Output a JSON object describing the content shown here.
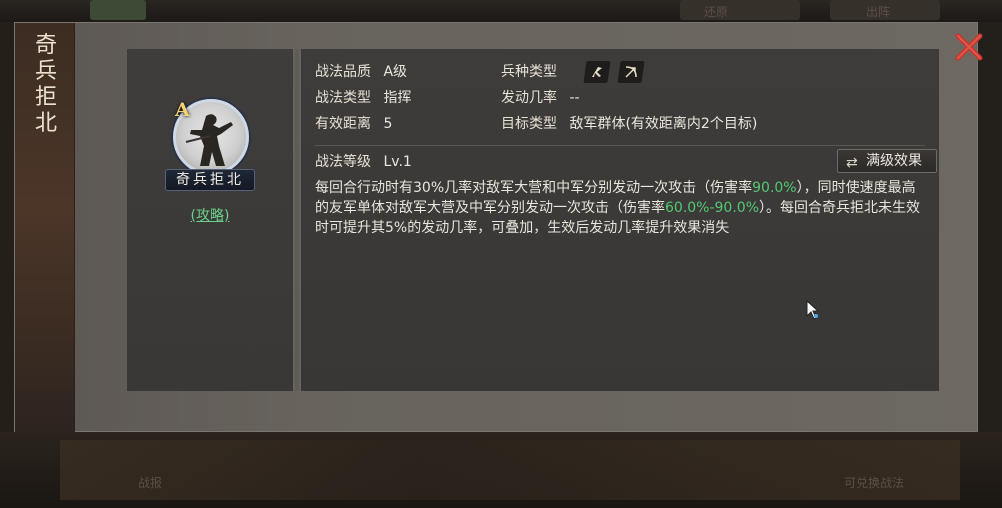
{
  "background": {
    "top_left_text": "",
    "top_right_text_1": "还原",
    "top_right_text_2": "出阵",
    "bottom_left_text": "战报",
    "bottom_right_text": "可兑换战法"
  },
  "dialog": {
    "vertical_title": [
      "奇",
      "兵",
      "拒",
      "北"
    ],
    "close_icon": "close-x-icon"
  },
  "skill_card": {
    "grade": "A",
    "name": "奇兵拒北",
    "guide_link": "(攻略)"
  },
  "info": {
    "quality_label": "战法品质",
    "quality_value": "A级",
    "troop_label": "兵种类型",
    "troop_icons": [
      "cavalry-icon",
      "archer-icon"
    ],
    "type_label": "战法类型",
    "type_value": "指挥",
    "rate_label": "发动几率",
    "rate_value": "--",
    "range_label": "有效距离",
    "range_value": "5",
    "target_label": "目标类型",
    "target_value": "敌军群体(有效距离内2个目标)",
    "level_label": "战法等级",
    "level_value": "Lv.1",
    "max_button_label": "满级效果",
    "description_parts": [
      "每回合行动时有30%几率对敌军大营和中军分别发动一次攻击（伤害率",
      "90.0%",
      "），同时使速度最高的友军单体对敌军大营及中军分别发动一次攻击（伤害率",
      "60.0%-90.0%",
      "）。每回合奇兵拒北未生效时可提升其5%的发动几率，可叠加，生效后发动几率提升效果消失"
    ]
  },
  "colors": {
    "highlight_green": "#53c873",
    "close_red": "#c8352c",
    "grade_gold": "#f4d270"
  }
}
